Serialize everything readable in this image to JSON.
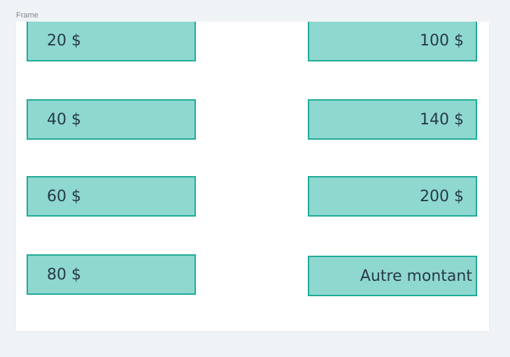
{
  "frame": {
    "label": "Frame"
  },
  "amounts": {
    "left": [
      "20 $",
      "40 $",
      "60 $",
      "80 $"
    ],
    "right": [
      "100 $",
      "140 $",
      "200 $",
      "Autre montant"
    ]
  },
  "colors": {
    "button_fill": "#8fd8cf",
    "button_border": "#1fab98",
    "button_text": "#263a48",
    "frame_bg": "#ffffff",
    "canvas_bg": "#f0f3f6"
  }
}
